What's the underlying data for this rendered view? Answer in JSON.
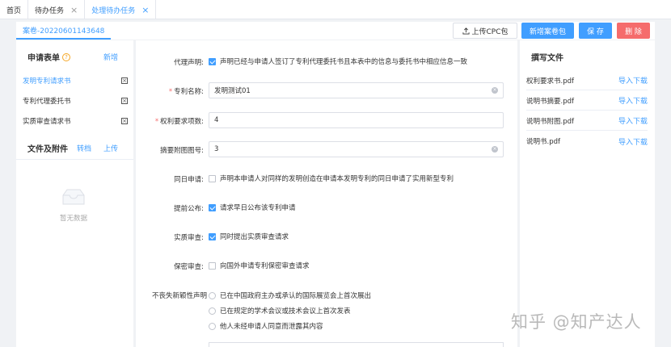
{
  "tabs": [
    {
      "label": "首页",
      "closable": false
    },
    {
      "label": "待办任务",
      "closable": true
    },
    {
      "label": "处理待办任务",
      "closable": true,
      "active": true
    }
  ],
  "case_tab": "案卷-20220601143648",
  "toolbar": {
    "upload_cpc": "上传CPC包",
    "new_case": "新增案卷包",
    "save": "保 存",
    "delete": "删 除"
  },
  "left": {
    "form_title": "申请表单",
    "form_add": "新增",
    "forms": [
      "发明专利请求书",
      "专利代理委托书",
      "实质审查请求书"
    ],
    "files_title": "文件及附件",
    "convert": "转档",
    "upload": "上传",
    "empty": "暂无数据"
  },
  "form": {
    "agent_label": "代理声明:",
    "agent_text": "声明已经与申请人签订了专利代理委托书且本表中的信息与委托书中相应信息一致",
    "name_label": "专利名称:",
    "name_value": "发明测试01",
    "claims_label": "权利要求项数:",
    "claims_value": "4",
    "abstract_fig_label": "摘要附图图号:",
    "abstract_fig_value": "3",
    "sameday_label": "同日申请:",
    "sameday_text": "声明本申请人对同样的发明创造在申请本发明专利的同日申请了实用新型专利",
    "early_label": "提前公布:",
    "early_text": "请求早日公布该专利申请",
    "exam_label": "实质审查:",
    "exam_text": "同时提出实质审查请求",
    "secret_label": "保密审查:",
    "secret_text": "向国外申请专利保密审查请求",
    "novelty_label": "不丧失新颖性声明",
    "novelty_options": [
      "已在中国政府主办或承认的国际展览会上首次展出",
      "已在规定的学术会议或技术会议上首次发表",
      "他人未经申请人同意而泄露其内容"
    ]
  },
  "right": {
    "title": "撰写文件",
    "files": [
      "权利要求书.pdf",
      "说明书摘要.pdf",
      "说明书附图.pdf",
      "说明书.pdf"
    ],
    "action": "导入下载"
  },
  "watermark": "知乎 @知产达人",
  "colors": {
    "primary": "#409eff",
    "danger": "#f56c6c"
  }
}
